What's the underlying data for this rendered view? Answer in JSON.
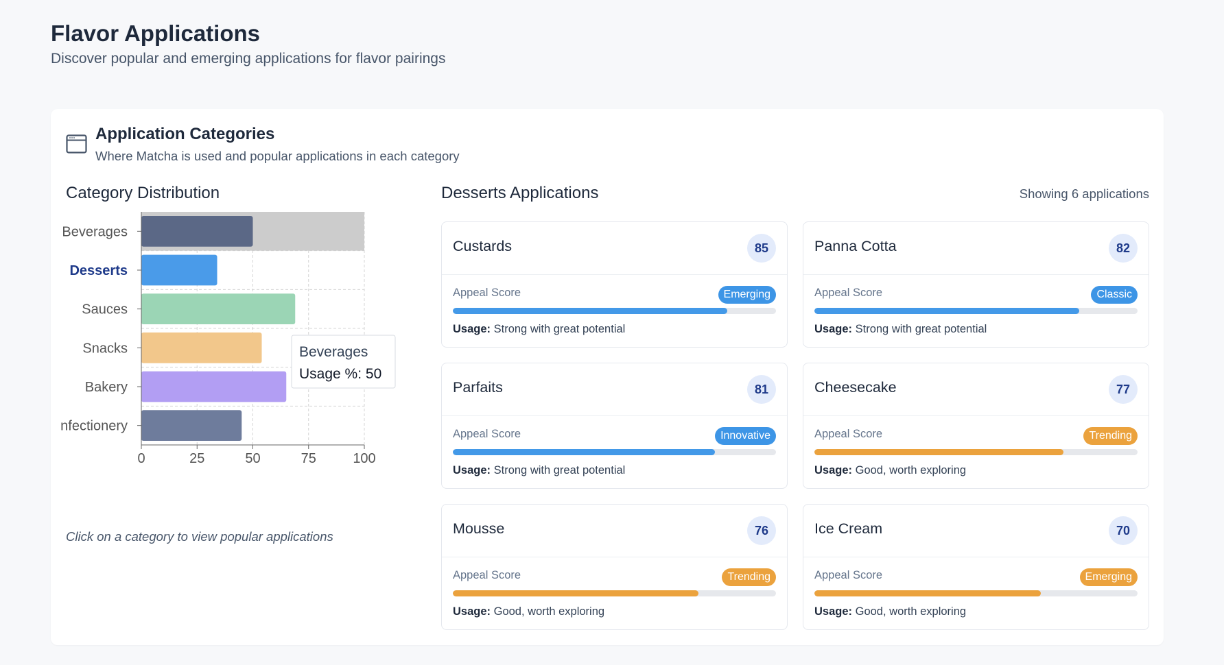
{
  "page": {
    "title": "Flavor Applications",
    "subtitle": "Discover popular and emerging applications for flavor pairings"
  },
  "card": {
    "icon": "browser-window-icon",
    "title": "Application Categories",
    "subtitle": "Where Matcha is used and popular applications in each category"
  },
  "distribution": {
    "title": "Category Distribution",
    "hint": "Click on a category to view popular applications"
  },
  "chart_data": {
    "type": "bar",
    "orientation": "horizontal",
    "categories": [
      "Beverages",
      "Desserts",
      "Sauces",
      "Snacks",
      "Bakery",
      "nfectionery"
    ],
    "series": [
      {
        "name": "Usage %",
        "values": [
          50,
          34,
          69,
          54,
          65,
          45
        ]
      }
    ],
    "colors": [
      "#5b6886",
      "#4a9be9",
      "#9bd5b5",
      "#f2c78b",
      "#b29ef3",
      "#6e7c9c"
    ],
    "xlim": [
      0,
      100
    ],
    "xticks": [
      "0",
      "25",
      "50",
      "75",
      "100"
    ],
    "grid": true,
    "selected_category": "Desserts",
    "hovered_category": "Beverages",
    "tooltip": {
      "title": "Beverages",
      "label": "Usage %",
      "separator": ": ",
      "value": "50"
    }
  },
  "applications": {
    "title": "Desserts Applications",
    "count_text": "Showing 6 applications",
    "appeal_label": "Appeal Score",
    "usage_prefix": "Usage:",
    "colors": {
      "blue": "#4399e8",
      "orange": "#eba23d"
    },
    "items": [
      {
        "name": "Custards",
        "score": "85",
        "tag": "Emerging",
        "tag_color": "blue",
        "fill": 0.85,
        "usage": "Strong with great potential"
      },
      {
        "name": "Panna Cotta",
        "score": "82",
        "tag": "Classic",
        "tag_color": "blue",
        "fill": 0.82,
        "usage": "Strong with great potential"
      },
      {
        "name": "Parfaits",
        "score": "81",
        "tag": "Innovative",
        "tag_color": "blue",
        "fill": 0.81,
        "usage": "Strong with great potential"
      },
      {
        "name": "Cheesecake",
        "score": "77",
        "tag": "Trending",
        "tag_color": "orange",
        "fill": 0.77,
        "usage": "Good, worth exploring"
      },
      {
        "name": "Mousse",
        "score": "76",
        "tag": "Trending",
        "tag_color": "orange",
        "fill": 0.76,
        "usage": "Good, worth exploring"
      },
      {
        "name": "Ice Cream",
        "score": "70",
        "tag": "Emerging",
        "tag_color": "orange",
        "fill": 0.7,
        "usage": "Good, worth exploring"
      }
    ]
  }
}
